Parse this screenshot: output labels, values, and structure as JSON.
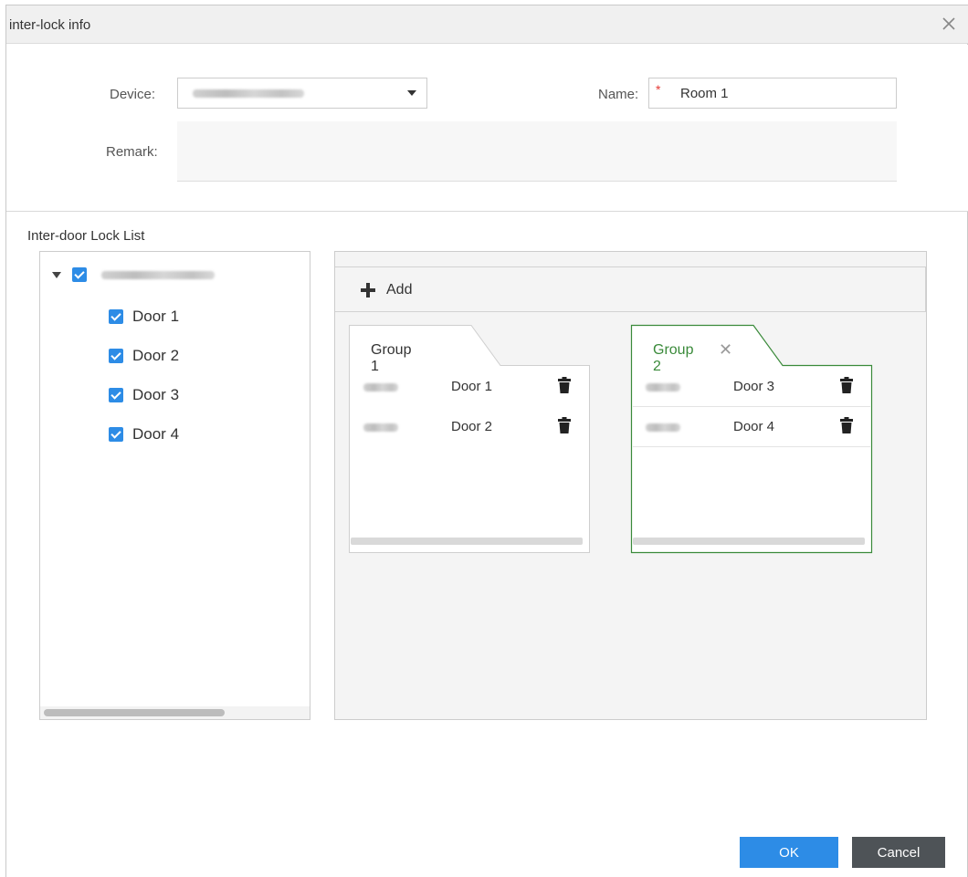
{
  "dialog": {
    "title": "inter-lock info",
    "close_icon": "close-icon"
  },
  "form": {
    "device_label": "Device:",
    "device_value_hidden": true,
    "name_label": "Name:",
    "name_required_mark": "*",
    "name_value": "Room 1",
    "remark_label": "Remark:",
    "remark_value": ""
  },
  "lock_list": {
    "title": "Inter-door Lock List",
    "device_checked": true,
    "doors": [
      {
        "label": "Door 1",
        "checked": true
      },
      {
        "label": "Door 2",
        "checked": true
      },
      {
        "label": "Door 3",
        "checked": true
      },
      {
        "label": "Door 4",
        "checked": true
      }
    ]
  },
  "groups_panel": {
    "add_label": "Add",
    "groups": [
      {
        "title": "Group 1",
        "active": false,
        "rows": [
          {
            "door": "Door 1"
          },
          {
            "door": "Door 2"
          }
        ]
      },
      {
        "title": "Group 2",
        "active": true,
        "rows": [
          {
            "door": "Door 3"
          },
          {
            "door": "Door 4"
          }
        ]
      }
    ]
  },
  "footer": {
    "ok_label": "OK",
    "cancel_label": "Cancel"
  },
  "colors": {
    "accent_blue": "#2d8ce6",
    "active_group_green": "#3a8a3a",
    "cancel_dark": "#4e5357",
    "required_red": "#e53935"
  }
}
